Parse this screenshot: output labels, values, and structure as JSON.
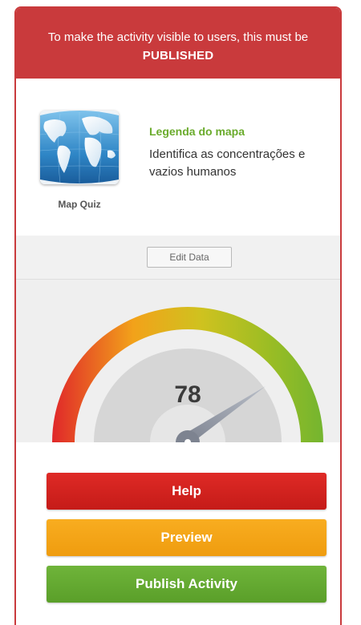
{
  "banner": {
    "line1": "To make the activity visible to users, this must be",
    "line2": "PUBLISHED"
  },
  "activity": {
    "type_label": "Map Quiz",
    "title": "Legenda do mapa",
    "description": "Identifica as concentrações e vazios humanos",
    "thumbnail_icon": "globe-map-icon"
  },
  "edit": {
    "label": "Edit Data"
  },
  "gauge": {
    "value": "78",
    "level": 0.78,
    "colors": [
      "#e0272a",
      "#f2a21a",
      "#cfc21f",
      "#74b52f"
    ]
  },
  "actions": {
    "help": "Help",
    "preview": "Preview",
    "publish": "Publish Activity"
  },
  "colors": {
    "banner": "#c93a3c",
    "title": "#6aab2c",
    "help": "#d4221f",
    "preview": "#f4a519",
    "publish": "#64aa32"
  }
}
